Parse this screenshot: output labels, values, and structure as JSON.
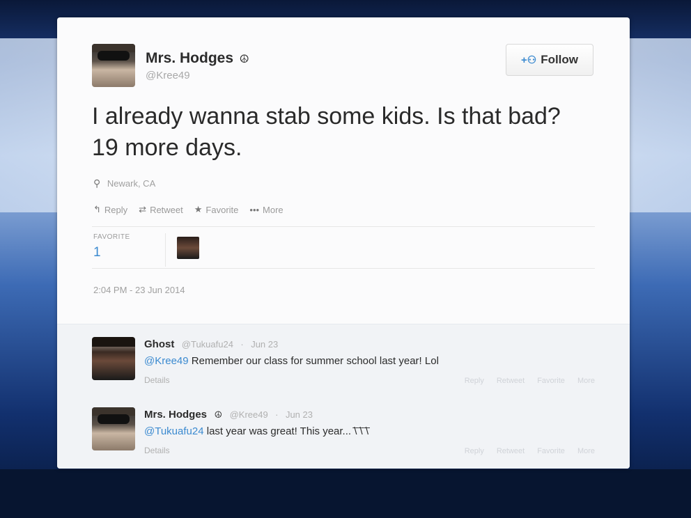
{
  "tweet": {
    "author_name": "Mrs. Hodges",
    "verified_glyph": "☮",
    "handle": "@Kree49",
    "follow_label": "Follow",
    "text": "I already wanna stab some kids. Is that bad? 19 more days.",
    "location": "Newark, CA",
    "actions": {
      "reply": "Reply",
      "retweet": "Retweet",
      "favorite": "Favorite",
      "more": "More"
    },
    "favorites_label": "FAVORITE",
    "favorites_count": "1",
    "timestamp": "2:04 PM - 23 Jun 2014"
  },
  "replies": [
    {
      "name": "Ghost",
      "handle": "@Tukuafu24",
      "date": "Jun 23",
      "mention": "@Kree49",
      "text": "Remember our class for summer school last year! Lol",
      "details": "Details"
    },
    {
      "name": "Mrs. Hodges",
      "verified_glyph": "☮",
      "handle": "@Kree49",
      "date": "Jun 23",
      "mention": "@Tukuafu24",
      "text": "last year was great! This year... ̄\\̄ ̄\\̄ ̄\\̄",
      "details": "Details"
    }
  ],
  "reply_actions": {
    "reply": "Reply",
    "retweet": "Retweet",
    "favorite": "Favorite",
    "more": "More"
  },
  "colors": {
    "link": "#3b8ad0",
    "text": "#2a2a2a",
    "muted": "#a0a0a0"
  },
  "icons": [
    "reply-icon",
    "retweet-icon",
    "star-icon",
    "more-icon",
    "location-pin-icon",
    "follow-user-icon"
  ]
}
